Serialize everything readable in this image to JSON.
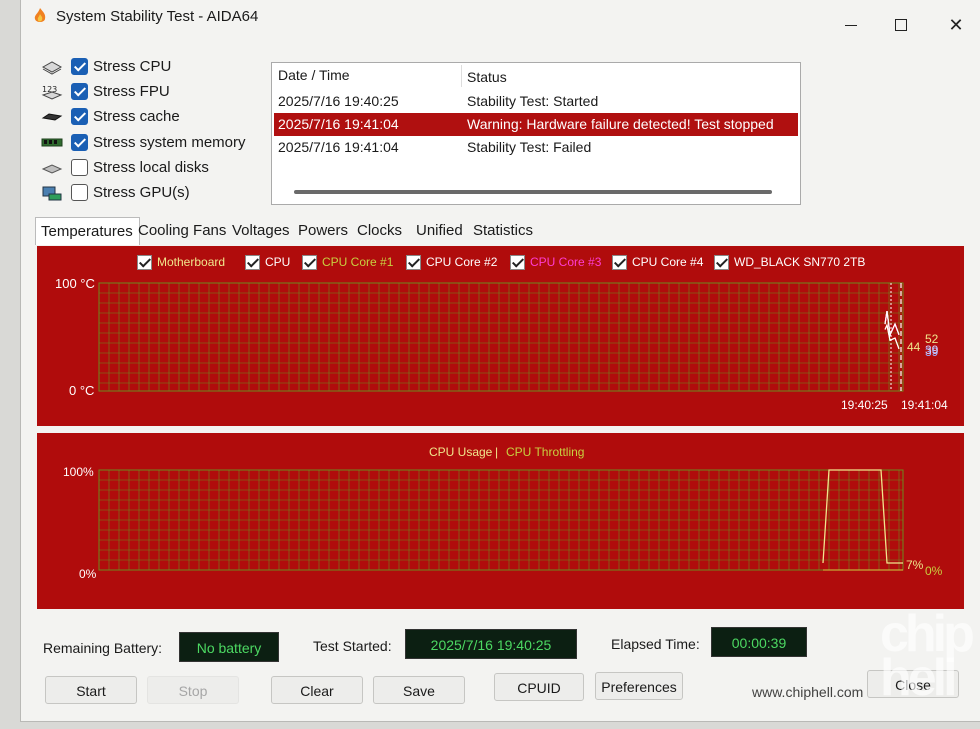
{
  "window": {
    "title": "System Stability Test - AIDA64"
  },
  "stress_options": [
    {
      "label": "Stress CPU",
      "checked": true,
      "icon": "cpu-chip-icon"
    },
    {
      "label": "Stress FPU",
      "checked": true,
      "icon": "fpu-123-icon"
    },
    {
      "label": "Stress cache",
      "checked": true,
      "icon": "cache-chip-icon"
    },
    {
      "label": "Stress system memory",
      "checked": true,
      "icon": "memory-module-icon"
    },
    {
      "label": "Stress local disks",
      "checked": false,
      "icon": "disk-icon"
    },
    {
      "label": "Stress GPU(s)",
      "checked": false,
      "icon": "gpu-card-icon"
    }
  ],
  "log": {
    "columns": [
      "Date / Time",
      "Status"
    ],
    "rows": [
      {
        "time": "2025/7/16 19:40:25",
        "status": "Stability Test: Started",
        "selected": false
      },
      {
        "time": "2025/7/16 19:41:04",
        "status": "Warning: Hardware failure detected! Test stopped",
        "selected": true
      },
      {
        "time": "2025/7/16 19:41:04",
        "status": "Stability Test: Failed",
        "selected": false
      }
    ]
  },
  "tabs": [
    "Temperatures",
    "Cooling Fans",
    "Voltages",
    "Powers",
    "Clocks",
    "Unified",
    "Statistics"
  ],
  "active_tab": "Temperatures",
  "temp_chart": {
    "legend": [
      {
        "label": "Motherboard",
        "color": "#f0e68c"
      },
      {
        "label": "CPU",
        "color": "#ffffff"
      },
      {
        "label": "CPU Core #1",
        "color": "#c8d040"
      },
      {
        "label": "CPU Core #2",
        "color": "#ffffff"
      },
      {
        "label": "CPU Core #3",
        "color": "#ff3cd2"
      },
      {
        "label": "CPU Core #4",
        "color": "#ffffff"
      },
      {
        "label": "WD_BLACK SN770 2TB",
        "color": "#ffffff"
      }
    ],
    "y_top_label": "100 °C",
    "y_bottom_label": "0 °C",
    "x_labels": [
      "19:40:25",
      "19:41:04"
    ],
    "end_values": [
      "52",
      "44",
      "39",
      "39"
    ]
  },
  "usage_chart": {
    "title_left": "CPU Usage",
    "title_sep": "|",
    "title_right": "CPU Throttling",
    "y_top_label": "100%",
    "y_bottom_label": "0%",
    "end_values": [
      "7%",
      "0%"
    ]
  },
  "chart_data": [
    {
      "type": "line",
      "title": "",
      "ylim": [
        0,
        100
      ],
      "x": [
        "19:40:25",
        "19:41:04"
      ],
      "series": [
        {
          "name": "Motherboard",
          "values": [
            39,
            39
          ]
        },
        {
          "name": "CPU",
          "values": [
            44,
            52
          ]
        },
        {
          "name": "CPU Core #1",
          "values": [
            44,
            52
          ]
        },
        {
          "name": "CPU Core #2",
          "values": [
            44,
            52
          ]
        },
        {
          "name": "CPU Core #3",
          "values": [
            44,
            52
          ]
        },
        {
          "name": "CPU Core #4",
          "values": [
            44,
            52
          ]
        },
        {
          "name": "WD_BLACK SN770 2TB",
          "values": [
            39,
            39
          ]
        }
      ],
      "grid": true
    },
    {
      "type": "line",
      "ylim": [
        0,
        100
      ],
      "series": [
        {
          "name": "CPU Usage",
          "values": [
            7,
            100,
            100,
            7
          ]
        },
        {
          "name": "CPU Throttling",
          "values": [
            0,
            0,
            0,
            0
          ]
        }
      ],
      "grid": true
    }
  ],
  "status": {
    "battery_label": "Remaining Battery:",
    "battery_value": "No battery",
    "started_label": "Test Started:",
    "started_value": "2025/7/16 19:40:25",
    "elapsed_label": "Elapsed Time:",
    "elapsed_value": "00:00:39"
  },
  "buttons": {
    "start": "Start",
    "stop": "Stop",
    "clear": "Clear",
    "save": "Save",
    "cpuid": "CPUID",
    "preferences": "Preferences",
    "close": "Close"
  },
  "watermark": {
    "text": "www.chiphell.com",
    "logo": "chip hell"
  },
  "colors": {
    "panel_bg": "#b00c0c",
    "grid": "#6d8a1e",
    "lcd_bg": "#0c1f12",
    "lcd_text": "#4cd862",
    "checkbox": "#1a5fb4"
  }
}
